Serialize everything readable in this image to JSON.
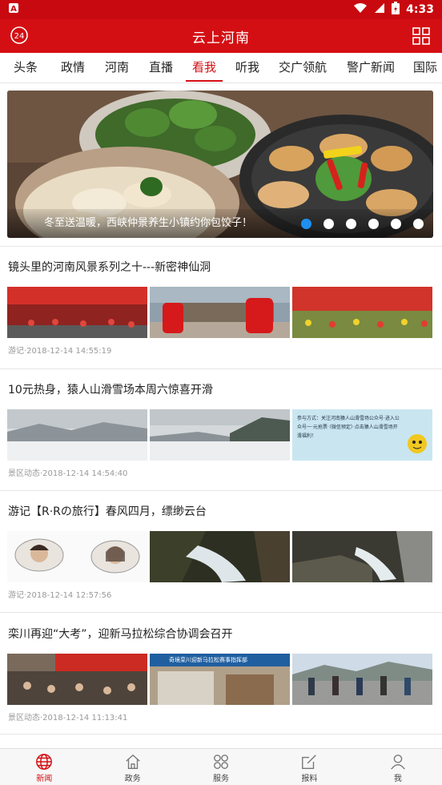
{
  "status_bar": {
    "time": "4:33",
    "notification_icon": "a-letter-icon",
    "icons": [
      "wifi-icon",
      "signal-icon",
      "battery-icon"
    ]
  },
  "header": {
    "title": "云上河南",
    "left_icon": "badge-24-icon",
    "right_icon": "grid-icon"
  },
  "tabs": [
    {
      "label": "头条"
    },
    {
      "label": "政情"
    },
    {
      "label": "河南"
    },
    {
      "label": "直播"
    },
    {
      "label": "看我",
      "active": true
    },
    {
      "label": "听我"
    },
    {
      "label": "交广领航"
    },
    {
      "label": "警广新闻"
    },
    {
      "label": "国际"
    }
  ],
  "banner": {
    "caption": "冬至送温暖，西峡仲景养生小镇约你包饺子！",
    "slide_count": 6,
    "active_slide": 1
  },
  "articles": [
    {
      "title": "镜头里的河南风景系列之十---新密神仙洞",
      "meta": "游记·2018-12-14 14:55:19",
      "thumb_texts": [
        "",
        "",
        ""
      ]
    },
    {
      "title": "10元热身，猿人山滑雪场本周六惊喜开滑",
      "meta": "景区动态·2018-12-14 14:54:40",
      "thumb_texts": [
        "",
        "",
        "参与方式：关注河南猿人山滑雪场公众号·进入公众号一·元抢票·（微信预定）·点击猿人山滑雪场开滑福利！"
      ]
    },
    {
      "title": "游记【R·Rの旅行】春风四月，缥缈云台",
      "meta": "游记·2018-12-14 12:57:56",
      "thumb_texts": [
        "",
        "",
        ""
      ]
    },
    {
      "title": "栾川再迎“大考”，迎新马拉松综合协调会召开",
      "meta": "景区动态·2018-12-14 11:13:41",
      "thumb_texts": [
        "",
        "奇境栾川迎新马拉松赛事指挥部",
        ""
      ]
    }
  ],
  "bottom_nav": [
    {
      "label": "新闻",
      "icon": "globe-icon",
      "active": true
    },
    {
      "label": "政务",
      "icon": "home-icon"
    },
    {
      "label": "服务",
      "icon": "apps-icon"
    },
    {
      "label": "报料",
      "icon": "edit-icon"
    },
    {
      "label": "我",
      "icon": "user-icon"
    }
  ],
  "colors": {
    "brand_red": "#d40f13",
    "status_red": "#c8090f",
    "active_dot": "#1f8ff0",
    "meta_gray": "#999999"
  }
}
